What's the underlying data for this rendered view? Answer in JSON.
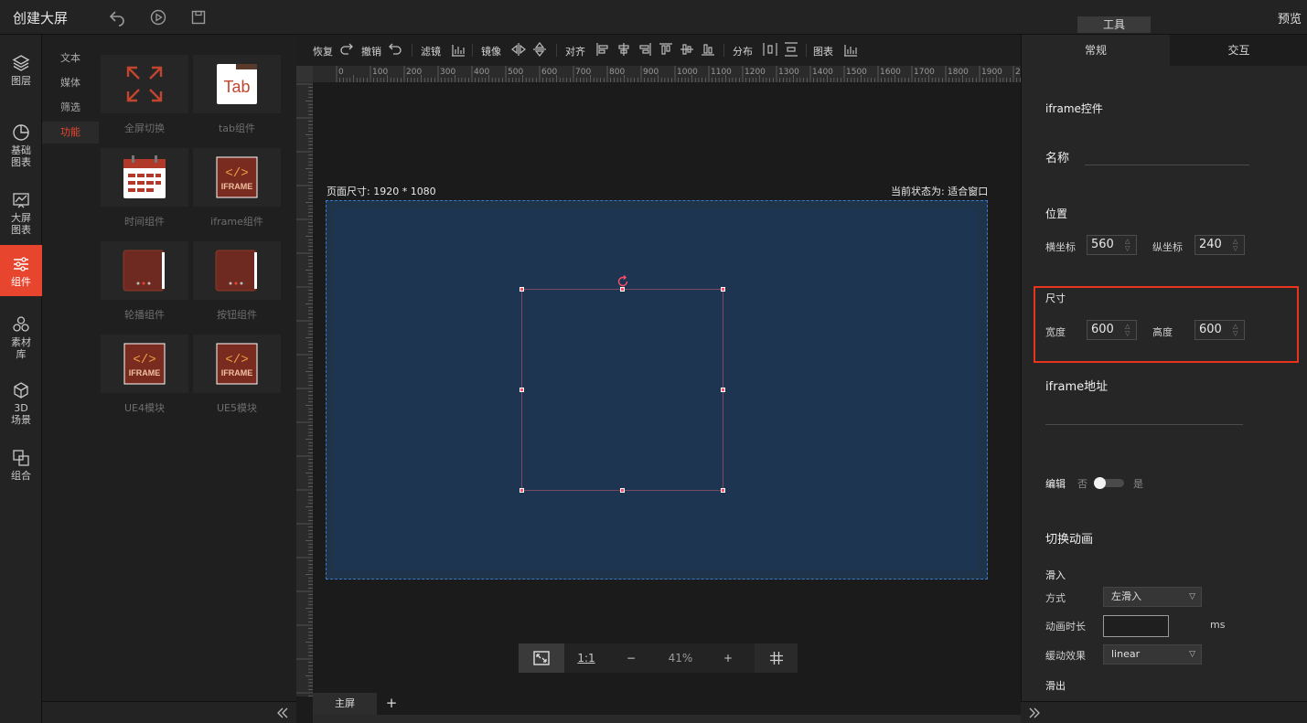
{
  "topbar": {
    "title": "创建大屏",
    "preview_label": "预览",
    "tools_label": "工具",
    "icons": [
      "undo-icon",
      "play-icon",
      "save-icon"
    ]
  },
  "rail": {
    "items": [
      {
        "label": "图层",
        "icon": "layers-icon"
      },
      {
        "label": "基础图表",
        "icon": "pie-chart-icon"
      },
      {
        "label": "大屏图表",
        "icon": "area-chart-icon"
      },
      {
        "label": "组件",
        "icon": "sliders-icon",
        "active": true
      },
      {
        "label": "素材库",
        "icon": "material-icon"
      },
      {
        "label": "3D场景",
        "icon": "cube-icon"
      },
      {
        "label": "组合",
        "icon": "group-icon"
      }
    ]
  },
  "categories": [
    "文本",
    "媒体",
    "筛选",
    "功能"
  ],
  "components": [
    {
      "label": "全屏切换",
      "icon": "fullscreen-icon"
    },
    {
      "label": "tab组件",
      "icon": "tab-icon",
      "icon_text": "Tab"
    },
    {
      "label": "时间组件",
      "icon": "calendar-icon"
    },
    {
      "label": "iframe组件",
      "icon": "iframe-icon",
      "icon_text": "IFRAME"
    },
    {
      "label": "轮播组件",
      "icon": "carousel-icon"
    },
    {
      "label": "按钮组件",
      "icon": "button-icon"
    },
    {
      "label": "UE4模块",
      "icon": "iframe-icon",
      "icon_text": "IFRAME"
    },
    {
      "label": "UE5模块",
      "icon": "iframe-icon",
      "icon_text": "IFRAME"
    }
  ],
  "toolbar": {
    "redo": "恢复",
    "undo": "撤销",
    "filter": "滤镜",
    "mirror": "镜像",
    "align": "对齐",
    "distribute": "分布",
    "chart": "图表"
  },
  "ruler_ticks": [
    "0",
    "100",
    "200",
    "300",
    "400",
    "500",
    "600",
    "700",
    "800",
    "900",
    "1000",
    "1100",
    "1200",
    "1300",
    "1400",
    "1500",
    "1600",
    "1700",
    "1800",
    "1900",
    "200"
  ],
  "canvas": {
    "page_size_label": "页面尺寸: 1920 * 1080",
    "state_label": "当前状态为: 适合窗口"
  },
  "zoom": {
    "ratio_label": "1:1",
    "minus": "−",
    "percent": "41%",
    "plus": "+"
  },
  "screen_tabs": {
    "main": "主屏",
    "add": "+"
  },
  "panel": {
    "tabs": [
      "常规",
      "交互"
    ],
    "component_title": "iframe控件",
    "name_label": "名称",
    "position_label": "位置",
    "x_label": "横坐标",
    "x_value": "560",
    "y_label": "纵坐标",
    "y_value": "240",
    "size_label": "尺寸",
    "width_label": "宽度",
    "width_value": "600",
    "height_label": "高度",
    "height_value": "600",
    "url_label": "iframe地址",
    "edit_label": "编辑",
    "edit_off": "否",
    "edit_on": "是",
    "edit_enabled": false,
    "anim_title": "切换动画",
    "slide_in": "滑入",
    "mode_label": "方式",
    "mode_value": "左滑入",
    "duration_label": "动画时长",
    "duration_unit": "ms",
    "easing_label": "缓动效果",
    "easing_value": "linear",
    "slide_out": "滑出"
  },
  "colors": {
    "accent": "#e8452e",
    "page_bg": "#1e3552",
    "highlight": "#e8341c",
    "selection_handle": "#ff4d6a"
  }
}
